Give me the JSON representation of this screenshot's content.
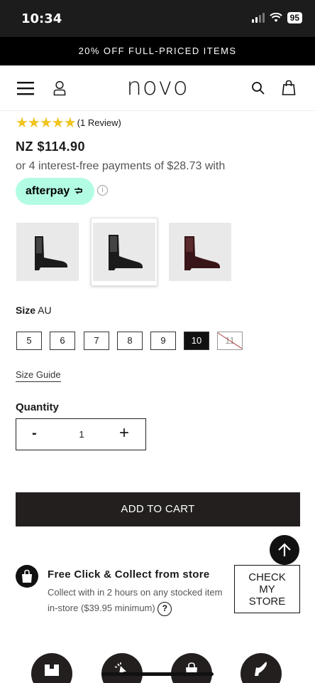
{
  "status_bar": {
    "time": "10:34",
    "battery": "95"
  },
  "promo_banner": "20% OFF FULL-PRICED ITEMS",
  "header": {
    "logo": "novo",
    "icons": [
      "menu-icon",
      "user-icon",
      "search-icon",
      "bag-icon"
    ]
  },
  "product": {
    "rating_stars": "★★★★★",
    "rating_value": 5,
    "review_count": "(1 Review)",
    "price": "NZ $114.90",
    "installments": "or 4 interest-free payments of $28.73 with",
    "afterpay_label": "afterpay",
    "info_symbol": "i",
    "thumbnails": [
      {
        "color": "#1b1b1b",
        "selected": false
      },
      {
        "color": "#1b1b1b",
        "selected": true
      },
      {
        "color": "#3a1517",
        "selected": false
      }
    ]
  },
  "size": {
    "label": "Size",
    "unit": "AU",
    "options": [
      {
        "label": "5",
        "state": "available"
      },
      {
        "label": "6",
        "state": "available"
      },
      {
        "label": "7",
        "state": "available"
      },
      {
        "label": "8",
        "state": "available"
      },
      {
        "label": "9",
        "state": "available"
      },
      {
        "label": "10",
        "state": "selected"
      },
      {
        "label": "11",
        "state": "unavailable"
      }
    ],
    "guide_label": "Size Guide"
  },
  "quantity": {
    "label": "Quantity",
    "minus": "-",
    "value": "1",
    "plus": "+"
  },
  "add_to_cart_label": "ADD TO CART",
  "click_collect": {
    "title": "Free Click & Collect from store",
    "description": "Collect with in 2 hours on any stocked item in-store ($39.95 minimum)",
    "help_symbol": "?",
    "button_lines": [
      "CHECK",
      "MY",
      "STORE"
    ]
  },
  "colors": {
    "promo_bg": "#000000",
    "afterpay_bg": "#b2fce4",
    "star": "#f3c321",
    "button_dark": "#231f1f"
  }
}
